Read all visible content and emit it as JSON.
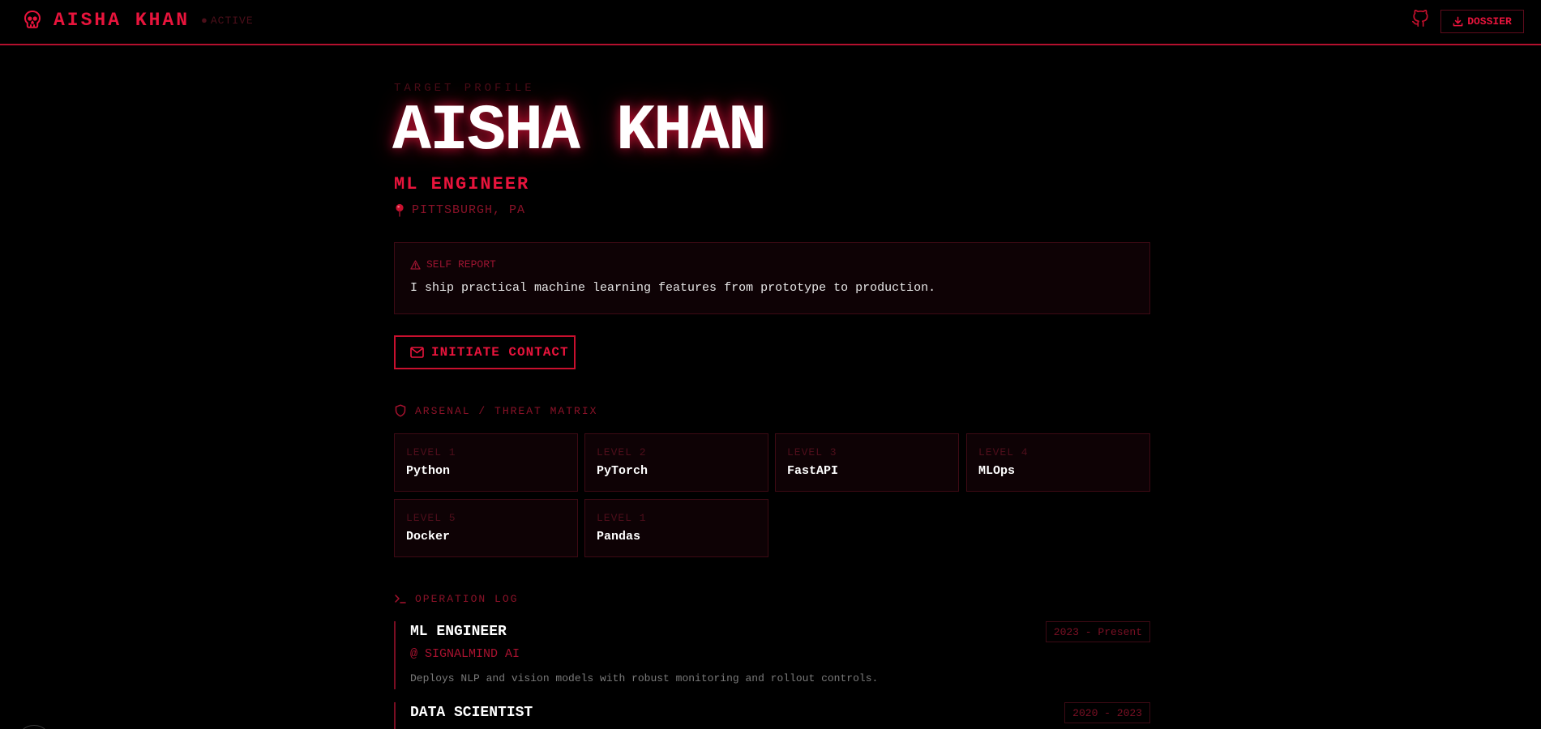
{
  "header": {
    "brand_name": "AISHA KHAN",
    "status_label": "ACTIVE",
    "dossier_label": "DOSSIER",
    "icons": {
      "brand": "skull-icon",
      "github": "github-icon",
      "download": "download-icon"
    }
  },
  "profile": {
    "eyebrow": "TARGET PROFILE",
    "name": "AISHA KHAN",
    "role": "ML ENGINEER",
    "location": "PITTSBURGH, PA"
  },
  "self_report": {
    "label": "SELF REPORT",
    "text": "I ship practical machine learning features from prototype to production."
  },
  "contact": {
    "label": "INITIATE CONTACT"
  },
  "arsenal": {
    "heading": "ARSENAL / THREAT MATRIX",
    "skills": [
      {
        "level": "LEVEL 1",
        "name": "Python"
      },
      {
        "level": "LEVEL 2",
        "name": "PyTorch"
      },
      {
        "level": "LEVEL 3",
        "name": "FastAPI"
      },
      {
        "level": "LEVEL 4",
        "name": "MLOps"
      },
      {
        "level": "LEVEL 5",
        "name": "Docker"
      },
      {
        "level": "LEVEL 1",
        "name": "Pandas"
      }
    ]
  },
  "operation_log": {
    "heading": "OPERATION LOG",
    "jobs": [
      {
        "title": "ML ENGINEER",
        "company": "@ SIGNALMIND AI",
        "dates": "2023 - Present",
        "description": "Deploys NLP and vision models with robust monitoring and rollout controls."
      },
      {
        "title": "DATA SCIENTIST",
        "dates": "2020 - 2023"
      }
    ]
  },
  "colors": {
    "background": "#000000",
    "accent": "#e8143c",
    "accent_dim": "#8a1228",
    "panel": "#0e0205",
    "border": "#3e0a14",
    "text": "#ffffff"
  }
}
